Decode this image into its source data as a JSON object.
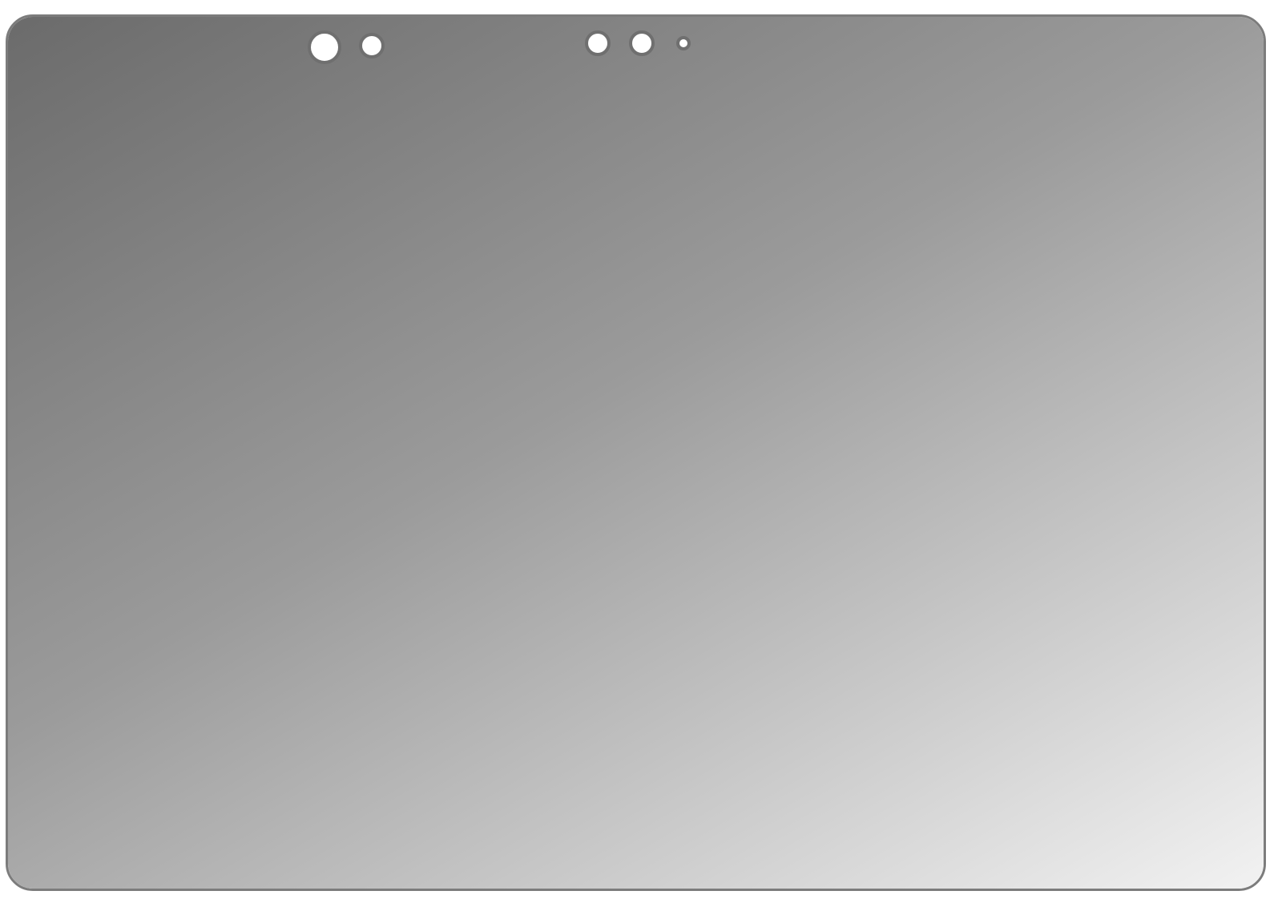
{
  "panel": {
    "kind": "glass screen protector",
    "gradient_start_color": "#6b6b6b",
    "gradient_end_color": "#f2f2f2",
    "border_color": "#7c7c7c"
  },
  "cutouts": [
    {
      "name": "front-camera-cutout",
      "size": "large"
    },
    {
      "name": "ir-sensor-cutout",
      "size": "medium"
    },
    {
      "name": "sensor-cutout-1",
      "size": "medium"
    },
    {
      "name": "sensor-cutout-2",
      "size": "medium"
    },
    {
      "name": "sensor-cutout-3",
      "size": "small"
    }
  ]
}
